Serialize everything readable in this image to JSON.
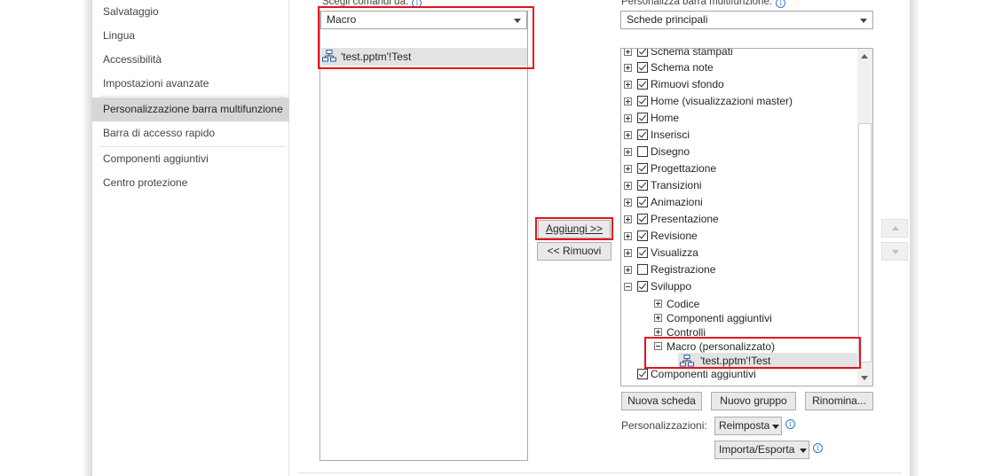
{
  "nav": {
    "items": [
      {
        "label": "Salvataggio"
      },
      {
        "label": "Lingua"
      },
      {
        "label": "Accessibilità"
      },
      {
        "label": "Impostazioni avanzate"
      },
      {
        "label": "Personalizzazione barra multifunzione"
      },
      {
        "label": "Barra di accesso rapido"
      },
      {
        "label": "Componenti aggiuntivi"
      },
      {
        "label": "Centro protezione"
      }
    ]
  },
  "left": {
    "label": "Scegli comandi da:",
    "dropdown_value": "Macro",
    "list_items": [
      {
        "label": "'test.pptm'!Test"
      }
    ]
  },
  "middle": {
    "add_button": "Aggiungi >>",
    "remove_button": "<< Rimuovi"
  },
  "right": {
    "label": "Personalizza barra multifunzione:",
    "dropdown_value": "Schede principali",
    "tree": [
      {
        "label": "Schema stampati"
      },
      {
        "label": "Schema note"
      },
      {
        "label": "Rimuovi sfondo"
      },
      {
        "label": "Home (visualizzazioni master)"
      },
      {
        "label": "Home"
      },
      {
        "label": "Inserisci"
      },
      {
        "label": "Disegno"
      },
      {
        "label": "Progettazione"
      },
      {
        "label": "Transizioni"
      },
      {
        "label": "Animazioni"
      },
      {
        "label": "Presentazione"
      },
      {
        "label": "Revisione"
      },
      {
        "label": "Visualizza"
      },
      {
        "label": "Registrazione"
      },
      {
        "label": "Sviluppo"
      },
      {
        "label": "Codice"
      },
      {
        "label": "Componenti aggiuntivi"
      },
      {
        "label": "Controlli"
      },
      {
        "label": "Macro (personalizzato)"
      },
      {
        "label": "'test.pptm'!Test"
      },
      {
        "label": "Componenti aggiuntivi"
      }
    ],
    "new_tab_button": "Nuova scheda",
    "new_group_button": "Nuovo gruppo",
    "rename_button": "Rinomina...",
    "customizations_label": "Personalizzazioni:",
    "reset_button": "Reimposta",
    "import_export_button": "Importa/Esporta"
  }
}
